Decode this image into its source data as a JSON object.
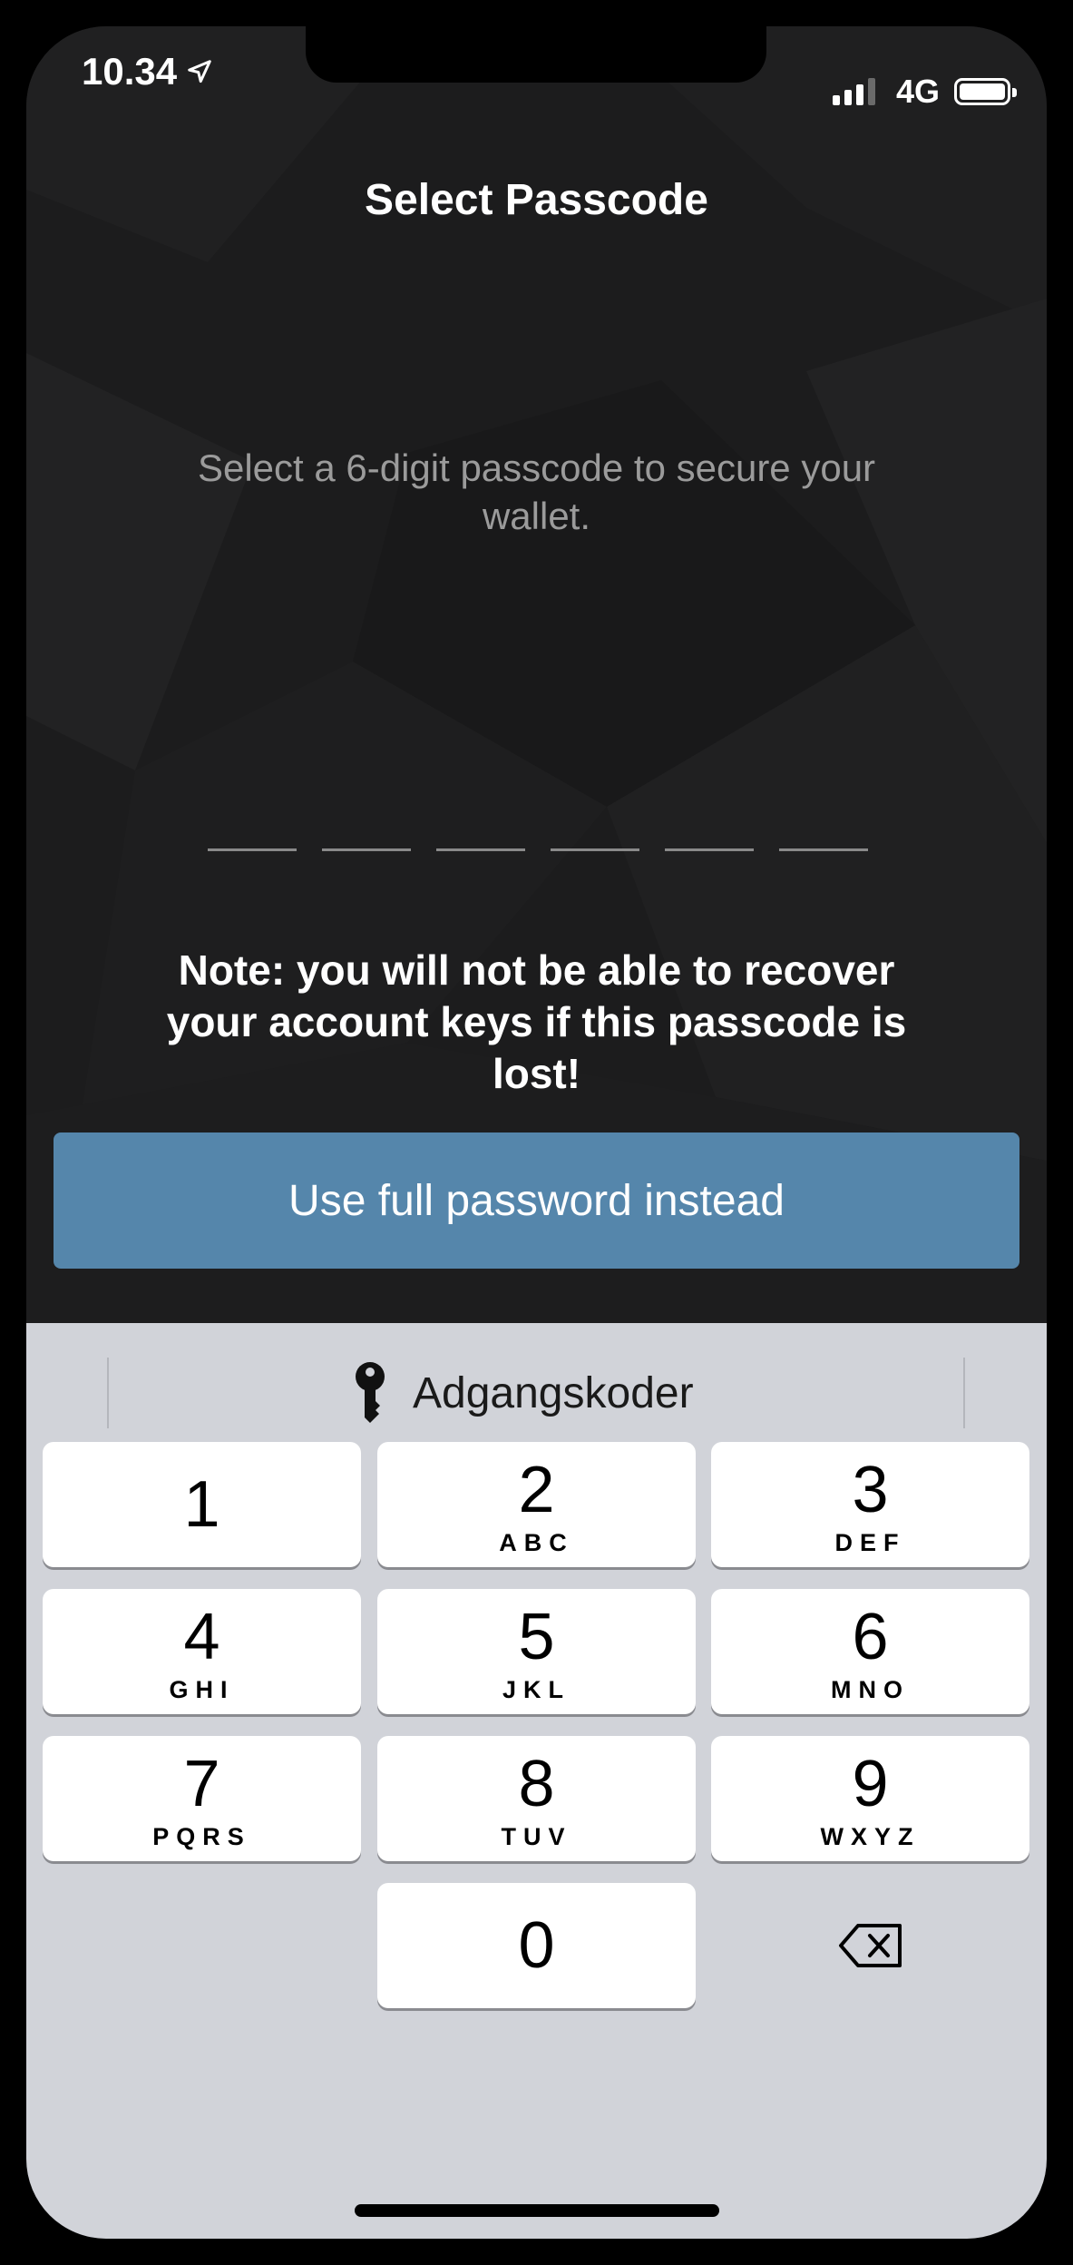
{
  "status_bar": {
    "time": "10.34",
    "network": "4G",
    "location_icon": "location-arrow-icon",
    "signal_icon": "cellular-signal-icon",
    "battery_icon": "battery-icon"
  },
  "header": {
    "title": "Select Passcode"
  },
  "main": {
    "subtitle": "Select a 6-digit passcode to secure your wallet.",
    "passcode_slots": 6,
    "note": "Note: you will not be able to recover your account keys if this passcode is lost!",
    "full_password_button": "Use full password instead"
  },
  "keyboard": {
    "suggestion_icon": "key-icon",
    "suggestion_label": "Adgangskoder",
    "keys": [
      {
        "digit": "1",
        "letters": ""
      },
      {
        "digit": "2",
        "letters": "ABC"
      },
      {
        "digit": "3",
        "letters": "DEF"
      },
      {
        "digit": "4",
        "letters": "GHI"
      },
      {
        "digit": "5",
        "letters": "JKL"
      },
      {
        "digit": "6",
        "letters": "MNO"
      },
      {
        "digit": "7",
        "letters": "PQRS"
      },
      {
        "digit": "8",
        "letters": "TUV"
      },
      {
        "digit": "9",
        "letters": "WXYZ"
      },
      {
        "digit": "0",
        "letters": ""
      }
    ],
    "delete_icon": "backspace-icon"
  },
  "colors": {
    "background": "#1c1c1d",
    "button": "#5586ab",
    "keyboard": "#d1d3d9",
    "subtitle": "#9b9b9b"
  }
}
